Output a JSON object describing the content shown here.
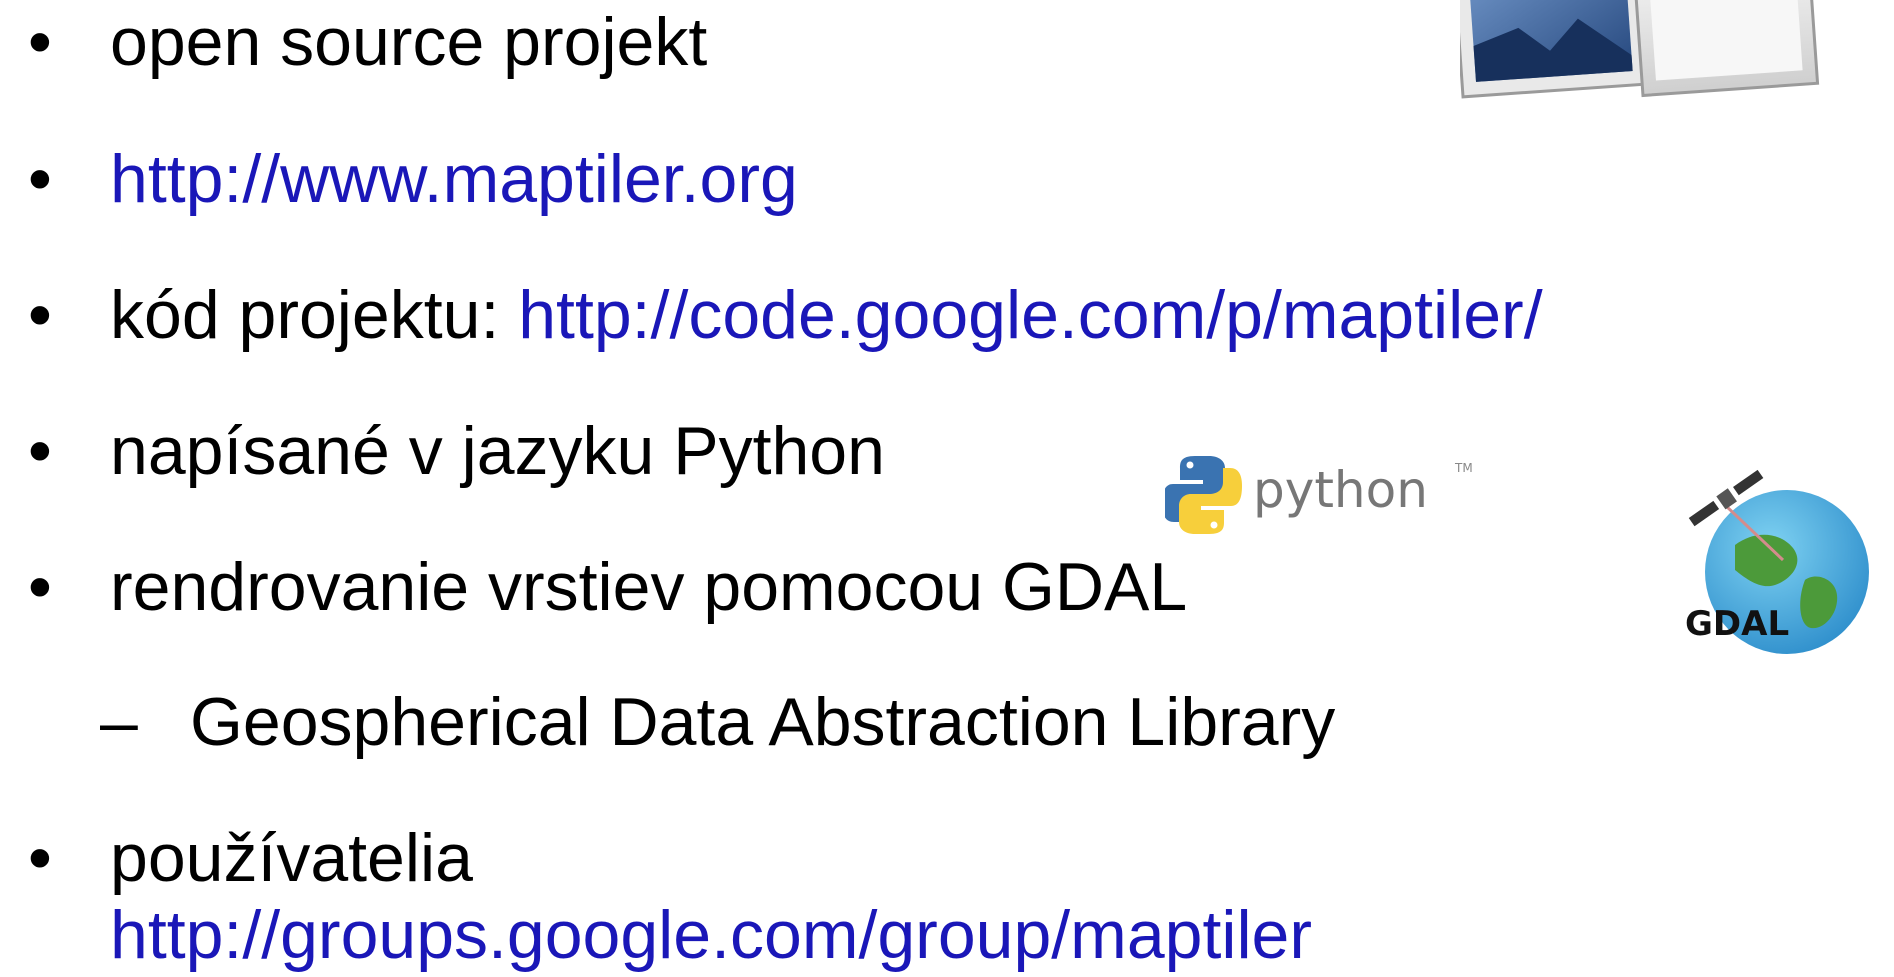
{
  "bullets": [
    {
      "text": "open source projekt"
    },
    {
      "link": "http://www.maptiler.org"
    },
    {
      "text": "kód projektu: ",
      "link": "http://code.google.com/p/maptiler/"
    },
    {
      "text": "napísané v jazyku Python"
    },
    {
      "text": "rendrovanie vrstiev pomocou GDAL"
    },
    {
      "sub_text": "Geospherical Data Abstraction Library"
    },
    {
      "text": "používatelia",
      "link": "http://groups.google.com/group/maptiler"
    }
  ],
  "logos": {
    "python": {
      "text": "python",
      "tm": "TM"
    },
    "gdal": {
      "text": "GDAL"
    }
  },
  "colors": {
    "link": "#1a17b8",
    "text": "#000000"
  },
  "icons": {
    "bullet": "•",
    "dash": "–"
  }
}
